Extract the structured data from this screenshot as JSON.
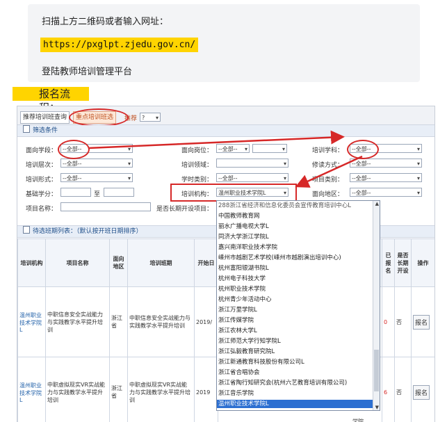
{
  "intro": {
    "line1": "扫描上方二维码或者输入网址：",
    "url": "https://pxglpt.zjedu.gov.cn/",
    "line3": "登陆教师培训管理平台"
  },
  "heading": "报名流程：",
  "tabs": {
    "tab1": "推荐培训班查询",
    "tab2": "重点培训班选",
    "tab3_label": "推荐",
    "tab3_value": "?"
  },
  "filter": {
    "title": "筛选条件",
    "fields": {
      "school_label": "面向学段：",
      "school_value": "--全部--",
      "post_label": "面向岗位：",
      "post_value": "--全部--",
      "subject_label": "培训学科：",
      "subject_value": "--全部--",
      "level_label": "培训层次：",
      "level_value": "--全部--",
      "domain_label": "培训领域：",
      "domain_value": "",
      "mode_label": "修读方式：",
      "mode_value": "--全部--",
      "form_label": "培训形式：",
      "form_value": "--全部--",
      "credit_type_label": "学时类别：",
      "credit_type_value": "--全部--",
      "item_type_label": "项目类别：",
      "item_type_value": "--全部--",
      "base_credit_label": "基础学分：",
      "base_credit_to": "至",
      "org_label": "培训机构：",
      "org_value": "温州职业技术学院L",
      "region_label": "面向地区：",
      "region_value": "--全部--",
      "project_label": "项目名称：",
      "longterm_label": "是否长期开设项目："
    }
  },
  "list": {
    "title": "待选班期列表：（默认按开班日期排序）",
    "headers": [
      "培训机构",
      "项目名称",
      "面向地区",
      "培训班期",
      "开始日",
      "已报名",
      "是否长期开设",
      "操作"
    ],
    "rows": [
      {
        "org": "温州职业技术学院L",
        "project": "中职信息安全实战能力与实践教学水平提升培训",
        "region": "浙江省",
        "class": "中职信息安全实战能力与实践教学水平提升培训",
        "start": "2019/",
        "enrolled": "0",
        "longterm": "否",
        "action": "报名"
      },
      {
        "org": "温州职业技术学院L",
        "project": "中职虚拟现实VR实战能力与实践教学水平提升培训",
        "region": "浙江省",
        "class": "中职虚拟现实VR实战能力与实践教学水平提升培训",
        "start": "2019",
        "enrolled": "6",
        "longterm": "否",
        "action": "报名"
      }
    ],
    "partial_text": "学院"
  },
  "dropdown": {
    "items": [
      "288浙江省经济和信息化委员会宣传教育培训中心L",
      "中国教师教育网",
      "丽水广播电视大学L",
      "同济大学浙江学院L",
      "嘉兴南洋职业技术学院",
      "嵊州市越剧艺术学校(嵊州市越剧演出培训中心)",
      "杭州富阳银湖书院L",
      "杭州电子科技大学",
      "杭州职业技术学院",
      "杭州青少年活动中心",
      "浙江万里学院L",
      "浙江传媒学院",
      "浙江农林大学L",
      "浙江师范大学行知学院L",
      "浙江弘毅教育研究院L",
      "浙江新通教育科技股份有限公司L",
      "浙江省合唱协会",
      "浙江省陶行知研究会(杭州六艺教育培训有限公司)",
      "浙江音乐学院",
      "温州职业技术学院L"
    ],
    "selected_index": 19
  },
  "colors": {
    "highlight": "#ffd400",
    "annotation_red": "#d62828",
    "selection_blue": "#2c6fd1"
  }
}
